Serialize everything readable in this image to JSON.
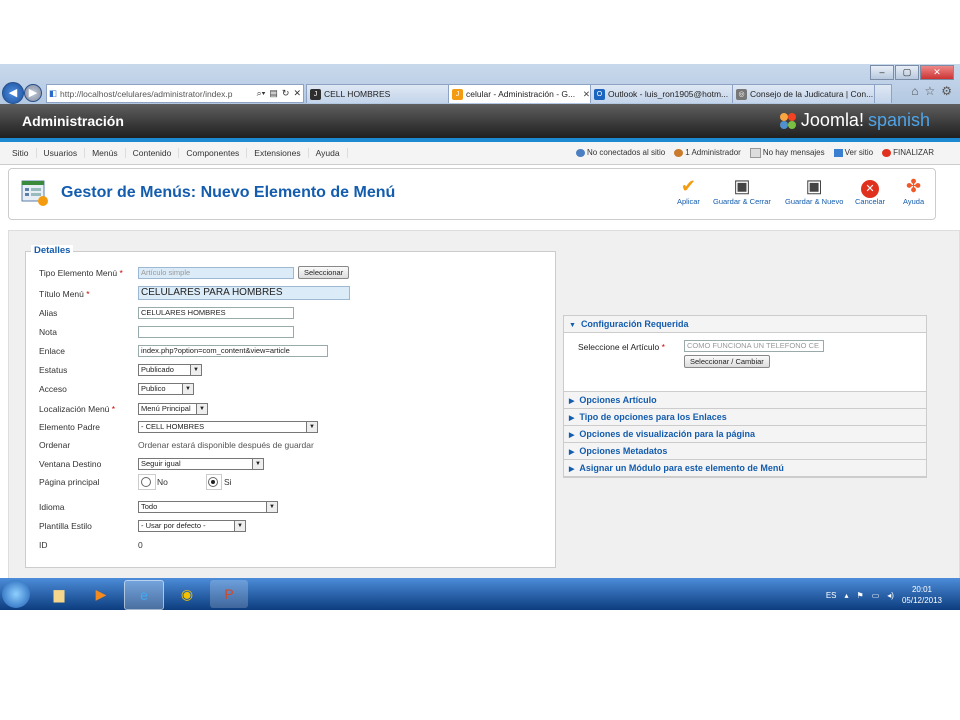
{
  "browser": {
    "address": "http://localhost/celulares/administrator/index.p",
    "address_host": "localhost",
    "tabs": [
      "CELL HOMBRES",
      "celular - Administración - G...",
      "Outlook - luis_ron1905@hotm...",
      "Consejo de la Judicatura | Con..."
    ],
    "window_buttons": [
      "–",
      "▢",
      "✕"
    ]
  },
  "admin": {
    "title": "Administración",
    "brand": "Joomla!",
    "brand_lang": "spanish"
  },
  "menu": {
    "items": [
      "Sitio",
      "Usuarios",
      "Menús",
      "Contenido",
      "Componentes",
      "Extensiones",
      "Ayuda"
    ],
    "status": [
      "No conectados al sitio",
      "1 Administrador",
      "No hay mensajes",
      "Ver sitio",
      "FINALIZAR"
    ]
  },
  "page": {
    "title": "Gestor de Menús: Nuevo Elemento de Menú",
    "toolbar": [
      "Aplicar",
      "Guardar & Cerrar",
      "Guardar & Nuevo",
      "Cancelar",
      "Ayuda"
    ]
  },
  "form": {
    "legend": "Detalles",
    "labels": {
      "tipo": "Tipo Elemento Menú",
      "titulo": "Título Menú",
      "alias": "Alias",
      "nota": "Nota",
      "enlace": "Enlace",
      "estatus": "Estatus",
      "acceso": "Acceso",
      "localizacion": "Localización Menú",
      "padre": "Elemento Padre",
      "ordenar": "Ordenar",
      "ventana": "Ventana Destino",
      "pagina": "Página principal",
      "idioma": "Idioma",
      "plantilla": "Plantilla Estilo",
      "id": "ID"
    },
    "values": {
      "tipo": "Artículo simple",
      "seleccionar": "Seleccionar",
      "titulo": "CELULARES PARA HOMBRES",
      "alias": "CELULARES HOMBRES",
      "nota": "",
      "enlace": "index.php?option=com_content&view=article",
      "estatus": "Publicado",
      "acceso": "Publico",
      "localizacion": "Menú Principal",
      "padre": "- CELL HOMBRES",
      "ordenar": "Ordenar estará disponible después de guardar",
      "ventana": "Seguir igual",
      "pagina_no": "No",
      "pagina_si": "Si",
      "idioma": "Todo",
      "plantilla": "- Usar por defecto -",
      "id": "0"
    },
    "required_mark": "*"
  },
  "right": {
    "open_title": "Configuración Requerida",
    "articulo_label": "Seleccione el Artículo",
    "articulo_value": "COMO FUNCIONA UN TELEFONO CE",
    "cambiar_button": "Seleccionar / Cambiar",
    "sections": [
      "Opciones Artículo",
      "Tipo de opciones para los Enlaces",
      "Opciones de visualización para la página",
      "Opciones Metadatos",
      "Asignar un Módulo para este elemento de Menú"
    ]
  },
  "taskbar": {
    "lang": "ES",
    "time": "20:01",
    "date": "05/12/2013"
  }
}
